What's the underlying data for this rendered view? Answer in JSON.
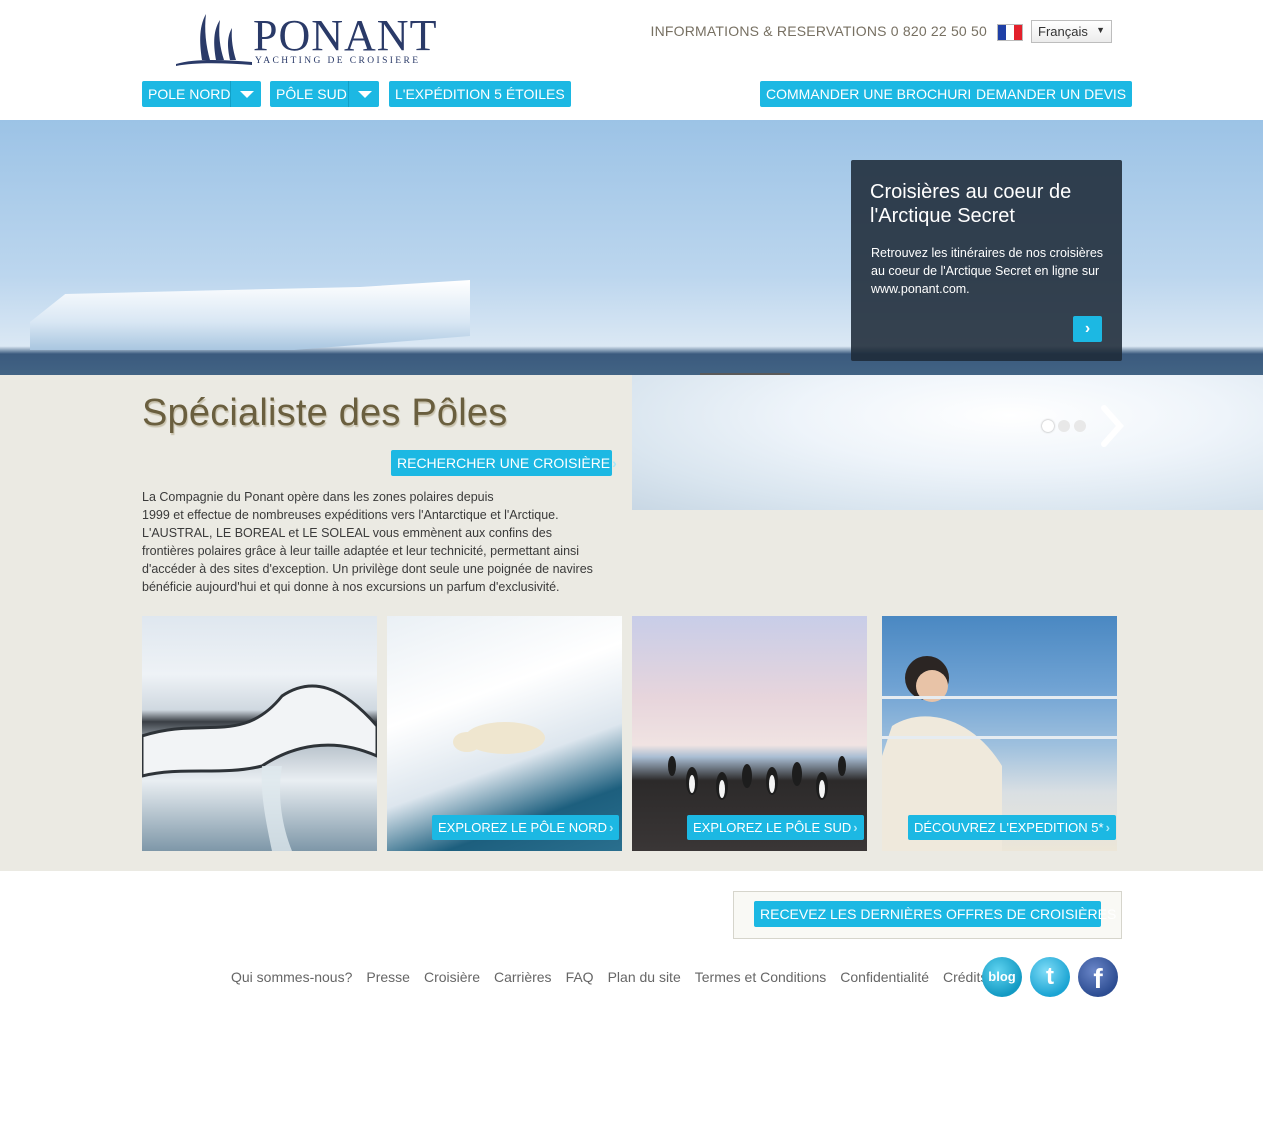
{
  "brand": {
    "name": "PONANT",
    "tagline": "YACHTING DE CROISIERE",
    "navy": "#2a3a68"
  },
  "topbar": {
    "info_text": "INFORMATIONS & RESERVATIONS",
    "phone": "0 820 22 50 50",
    "flag_icon": "french-flag-icon",
    "language": "Français"
  },
  "nav": {
    "pole_nord": "POLE NORD",
    "pole_sud": "PÔLE SUD",
    "expedition": "L'EXPÉDITION 5 ÉTOILES",
    "brochure": "COMMANDER UNE BROCHURE",
    "devis": "DEMANDER UN DEVIS"
  },
  "hero": {
    "promo_title": "Croisières au coeur de l'Arctique Secret",
    "promo_text": "Retrouvez les itinéraires de nos croisières au coeur de l'Arctique Secret en ligne sur www.ponant.com.",
    "promo_arrow": "›",
    "slides_total": 3,
    "active_slide": 1
  },
  "intro": {
    "headline": "Spécialiste des Pôles",
    "search_button": "RECHERCHER UNE CROISIÈRE",
    "lines": [
      "La Compagnie du Ponant opère dans les zones polaires depuis",
      "1999 et effectue de nombreuses expéditions vers l'Antarctique et l'Arctique.",
      "L'AUSTRAL, LE BOREAL et LE SOLEAL vous emmènent aux confins des",
      "frontières polaires grâce à leur taille adaptée et leur technicité, permettant ainsi",
      "d'accéder à des sites d'exception. Un privilège dont seule une poignée de navires",
      "bénéficie aujourd'hui et qui donne à nos excursions un parfum d'exclusivité."
    ]
  },
  "tiles": [
    {
      "image": "whale-tail-photo",
      "button": ""
    },
    {
      "image": "polar-bear-photo",
      "button": "EXPLOREZ LE PÔLE NORD"
    },
    {
      "image": "penguins-photo",
      "button": "EXPLOREZ LE PÔLE SUD"
    },
    {
      "image": "deck-passenger-photo",
      "button": "DÉCOUVREZ L'EXPEDITION 5*"
    }
  ],
  "footer": {
    "newsletter_button": "RECEVEZ LES DERNIÈRES OFFRES DE CROISIÈRES",
    "links": [
      "Qui sommes-nous?",
      "Presse",
      "Croisière",
      "Carrières",
      "FAQ",
      "Plan du site",
      "Termes et Conditions",
      "Confidentialité",
      "Crédits"
    ],
    "blog_label": "blog",
    "twitter_glyph": "t",
    "facebook_glyph": "f"
  },
  "colors": {
    "accent": "#1cb8e3",
    "band": "#ebeae3",
    "headline": "#6a5f3f"
  }
}
